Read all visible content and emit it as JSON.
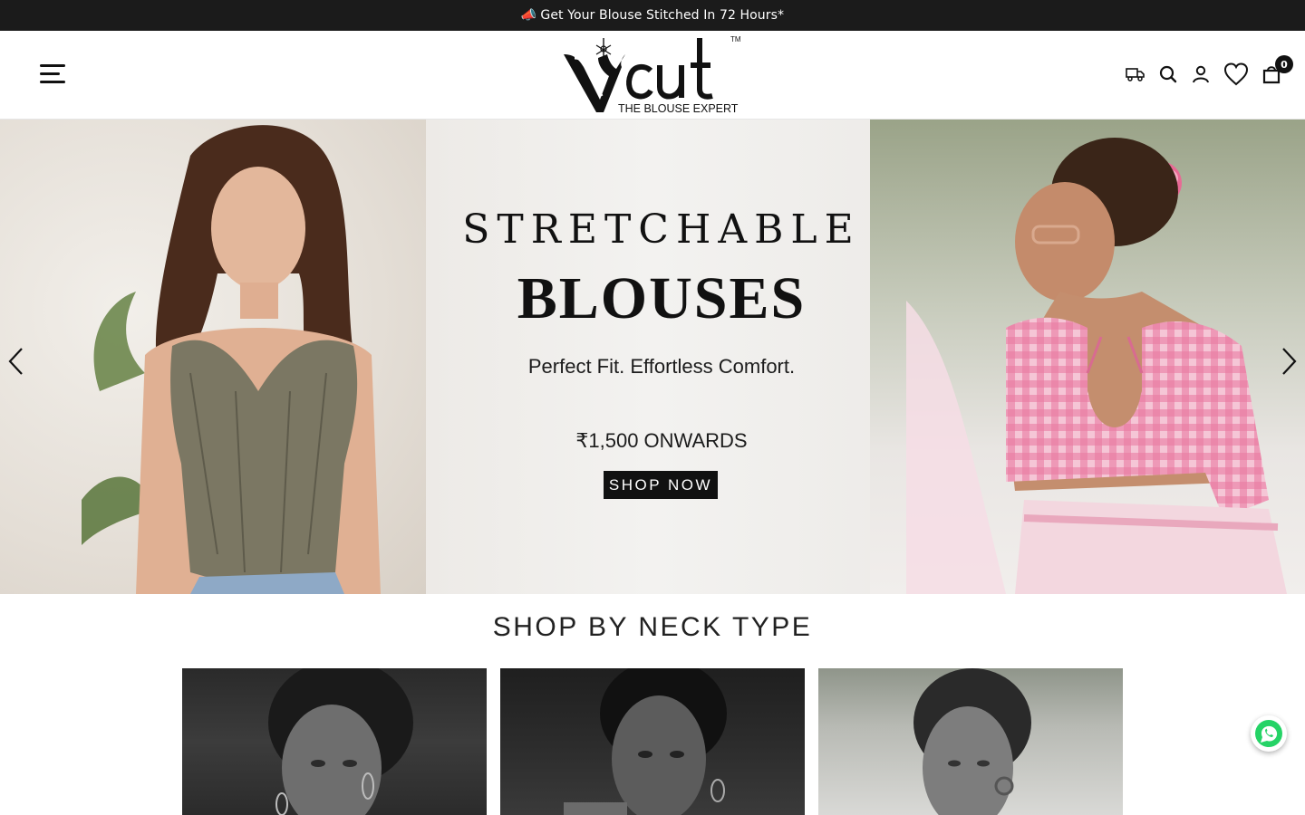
{
  "announcement": {
    "text": "Get Your Blouse Stitched In 72 Hours*",
    "icon": "megaphone-icon"
  },
  "header": {
    "logo": {
      "wordmark": "Vcut",
      "trademark": "TM",
      "tagline": "THE BLOUSE EXPERT"
    },
    "icons": [
      "menu-icon",
      "delivery-truck-icon",
      "search-icon",
      "account-icon",
      "wishlist-heart-icon",
      "cart-bag-icon"
    ],
    "cart_count": "0"
  },
  "hero": {
    "title_line1": "STRETCHABLE",
    "title_line2": "BLOUSES",
    "subtitle": "Perfect Fit. Effortless Comfort.",
    "price": "₹1,500 ONWARDS",
    "cta_label": "SHOP NOW",
    "prev_icon": "chevron-left-icon",
    "next_icon": "chevron-right-icon"
  },
  "neck_section": {
    "title": "SHOP BY NECK TYPE"
  },
  "floating": {
    "whatsapp_icon": "whatsapp-icon"
  },
  "colors": {
    "announcement_bg": "#1b1b1b",
    "text_primary": "#111111",
    "cta_bg": "#111111",
    "whatsapp_green": "#25d366"
  }
}
